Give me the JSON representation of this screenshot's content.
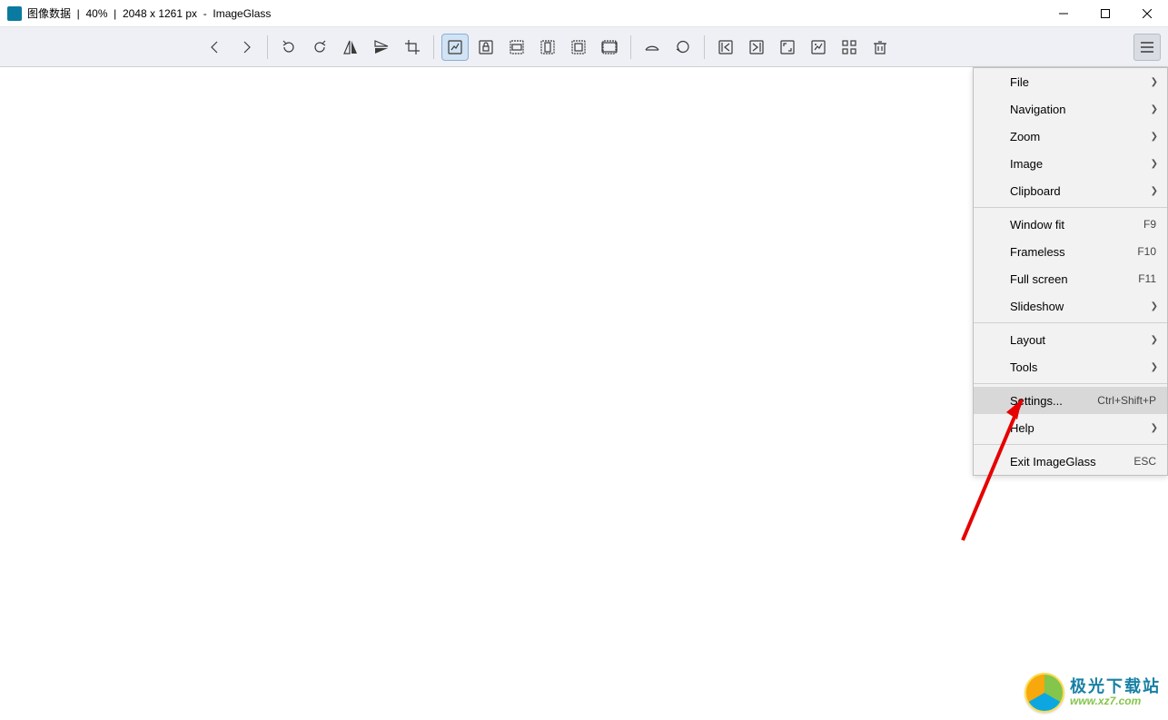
{
  "title": {
    "app_icon_letter": "IG",
    "filename": "图像数据",
    "sep1": "  |  ",
    "zoom": "40%",
    "sep2": "  |  ",
    "dimensions": "2048 x 1261 px",
    "sep3": "  -  ",
    "appname": "ImageGlass"
  },
  "toolbar": {
    "buttons": [
      {
        "name": "prev-button",
        "icon": "chevron-left"
      },
      {
        "name": "next-button",
        "icon": "chevron-right"
      },
      {
        "sep": true
      },
      {
        "name": "rotate-ccw-button",
        "icon": "rotate-ccw"
      },
      {
        "name": "rotate-cw-button",
        "icon": "rotate-cw"
      },
      {
        "name": "flip-h-button",
        "icon": "flip-h"
      },
      {
        "name": "flip-v-button",
        "icon": "flip-v"
      },
      {
        "name": "crop-button",
        "icon": "crop"
      },
      {
        "sep": true
      },
      {
        "name": "auto-zoom-button",
        "icon": "auto-zoom",
        "active": true
      },
      {
        "name": "lock-zoom-button",
        "icon": "lock"
      },
      {
        "name": "scale-to-width-button",
        "icon": "scale-width"
      },
      {
        "name": "scale-to-height-button",
        "icon": "scale-height"
      },
      {
        "name": "scale-to-fit-button",
        "icon": "scale-fit"
      },
      {
        "name": "scale-to-fill-button",
        "icon": "scale-fill"
      },
      {
        "sep": true
      },
      {
        "name": "open-file-button",
        "icon": "open"
      },
      {
        "name": "refresh-button",
        "icon": "refresh"
      },
      {
        "sep": true
      },
      {
        "name": "goto-first-button",
        "icon": "goto-first"
      },
      {
        "name": "goto-last-button",
        "icon": "goto-last"
      },
      {
        "name": "window-fit-button",
        "icon": "window-fit"
      },
      {
        "name": "actual-size-button",
        "icon": "actual-size"
      },
      {
        "name": "thumbnail-button",
        "icon": "thumbnail"
      },
      {
        "name": "delete-button",
        "icon": "trash"
      }
    ]
  },
  "menu": {
    "items": [
      {
        "label": "File",
        "submenu": true
      },
      {
        "label": "Navigation",
        "submenu": true
      },
      {
        "label": "Zoom",
        "submenu": true
      },
      {
        "label": "Image",
        "submenu": true
      },
      {
        "label": "Clipboard",
        "submenu": true
      },
      {
        "sep": true
      },
      {
        "label": "Window fit",
        "shortcut": "F9"
      },
      {
        "label": "Frameless",
        "shortcut": "F10"
      },
      {
        "label": "Full screen",
        "shortcut": "F11"
      },
      {
        "label": "Slideshow",
        "submenu": true
      },
      {
        "sep": true
      },
      {
        "label": "Layout",
        "submenu": true
      },
      {
        "label": "Tools",
        "submenu": true
      },
      {
        "sep": true
      },
      {
        "label": "Settings...",
        "shortcut": "Ctrl+Shift+P",
        "hovered": true
      },
      {
        "label": "Help",
        "submenu": true
      },
      {
        "sep": true
      },
      {
        "label": "Exit ImageGlass",
        "shortcut": "ESC"
      }
    ]
  },
  "watermark": {
    "title": "极光下载站",
    "url": "www.xz7.com"
  }
}
